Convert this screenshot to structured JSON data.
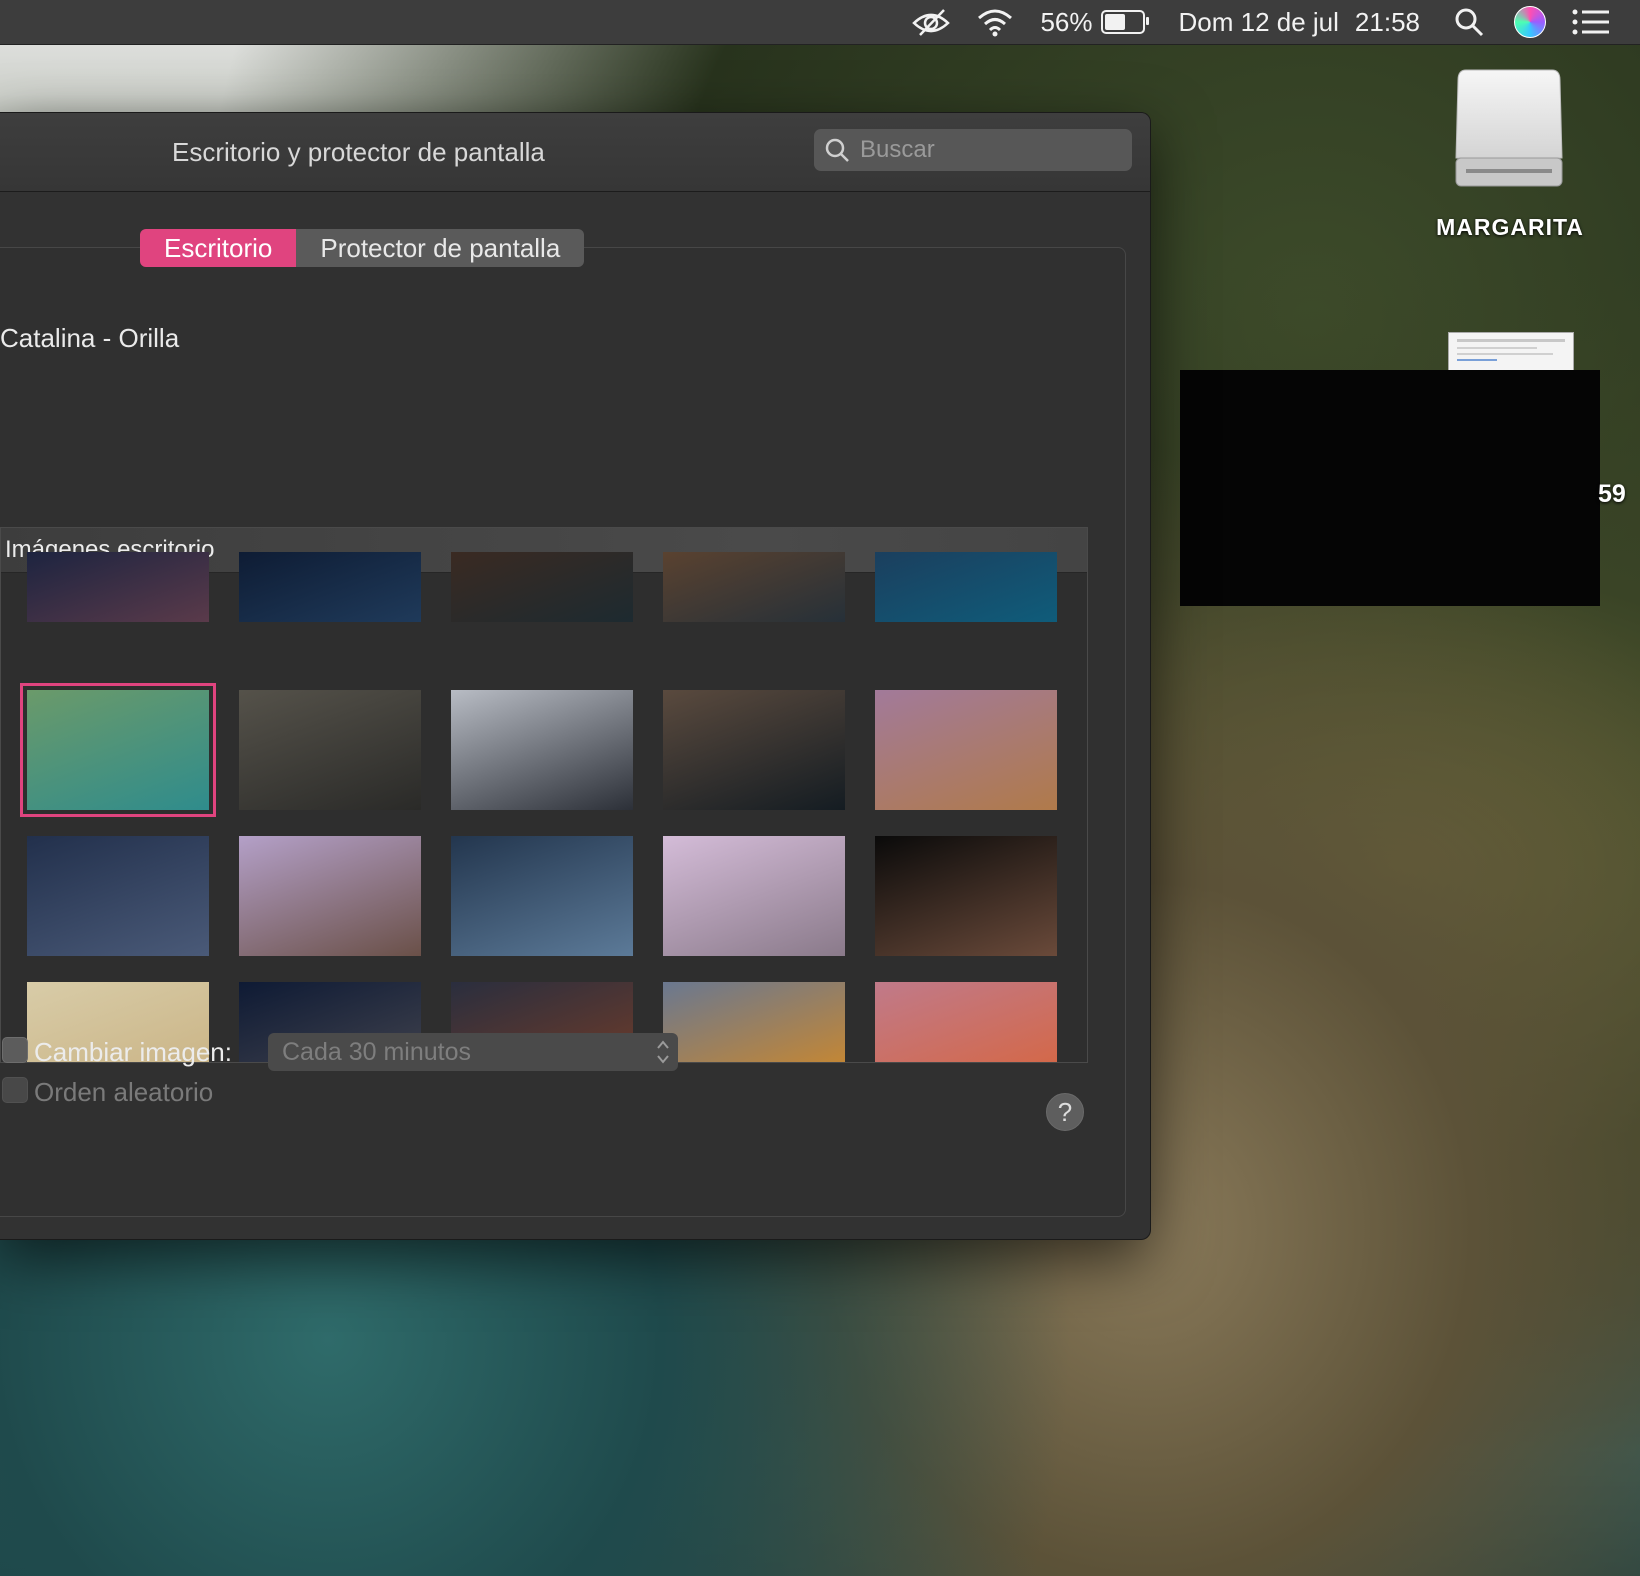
{
  "menubar": {
    "battery_percent_text": "56%",
    "battery_level": 0.56,
    "date": "Dom 12 de jul",
    "time": "21:58",
    "icons": [
      "eye-slash-icon",
      "wifi-icon",
      "battery-icon",
      "spotlight-search-icon",
      "siri-icon",
      "notification-center-icon"
    ]
  },
  "window": {
    "title": "Escritorio y protector de pantalla",
    "search_placeholder": "Buscar",
    "tabs": [
      {
        "label": "Escritorio",
        "active": true
      },
      {
        "label": "Protector de pantalla",
        "active": false
      }
    ],
    "current_picture_name": "Catalina - Orilla",
    "gallery_header": "Imágenes escritorio",
    "change_picture_label": "Cambiar imagen:",
    "change_interval": "Cada 30 minutos",
    "random_order_label": "Orden aleatorio",
    "help_label": "?"
  },
  "desktop": {
    "drive_label": "MARGARITA",
    "partial_text": "59"
  },
  "colors": {
    "accent": "#e0447f",
    "window_bg": "#323232",
    "menubar_bg": "#3d3d3d"
  },
  "thumbnails": [
    {
      "name": "catalina-evening",
      "c1": "#1d2440",
      "c2": "#5a3a4a",
      "selected": false
    },
    {
      "name": "catalina-night",
      "c1": "#0e1c34",
      "c2": "#1f3a5a",
      "selected": false
    },
    {
      "name": "catalina-sunset",
      "c1": "#3a2a22",
      "c2": "#1d2a30",
      "selected": false
    },
    {
      "name": "catalina-rock",
      "c1": "#5a4230",
      "c2": "#263038",
      "selected": false
    },
    {
      "name": "catalina-ocean",
      "c1": "#1b3f5e",
      "c2": "#0f5c7a",
      "selected": false
    },
    {
      "name": "catalina-orilla",
      "c1": "#6b9a6a",
      "c2": "#2f8c8c",
      "selected": true
    },
    {
      "name": "catalina-clouds",
      "c1": "#55524a",
      "c2": "#2a2a28",
      "selected": false
    },
    {
      "name": "catalina-island",
      "c1": "#b8bcc4",
      "c2": "#2c3038",
      "selected": false
    },
    {
      "name": "catalina-fog",
      "c1": "#5a4a3e",
      "c2": "#141c22",
      "selected": false
    },
    {
      "name": "mojave-day",
      "c1": "#a27a9a",
      "c2": "#b07a4a",
      "selected": false
    },
    {
      "name": "mojave-night-dune",
      "c1": "#22304c",
      "c2": "#4a5a78",
      "selected": false
    },
    {
      "name": "desert-pinnacle",
      "c1": "#b4a0c8",
      "c2": "#6a5048",
      "selected": false
    },
    {
      "name": "salt-flat",
      "c1": "#23364e",
      "c2": "#5c7a98",
      "selected": false
    },
    {
      "name": "mono-lake",
      "c1": "#d4bcd8",
      "c2": "#8a7a8a",
      "selected": false
    },
    {
      "name": "tufa-night",
      "c1": "#0a0a0a",
      "c2": "#6a4a3a",
      "selected": false
    },
    {
      "name": "sand-dunes-light",
      "c1": "#d8cca8",
      "c2": "#c8b080",
      "selected": false
    },
    {
      "name": "dark-dune",
      "c1": "#0e1a34",
      "c2": "#4a4a52",
      "selected": false
    },
    {
      "name": "red-rocks",
      "c1": "#2a2e3e",
      "c2": "#7a3e26",
      "selected": false
    },
    {
      "name": "high-sierra",
      "c1": "#6a7890",
      "c2": "#d88a20",
      "selected": false
    },
    {
      "name": "sierra-sunset",
      "c1": "#c07a8a",
      "c2": "#d8643a",
      "selected": false
    }
  ]
}
